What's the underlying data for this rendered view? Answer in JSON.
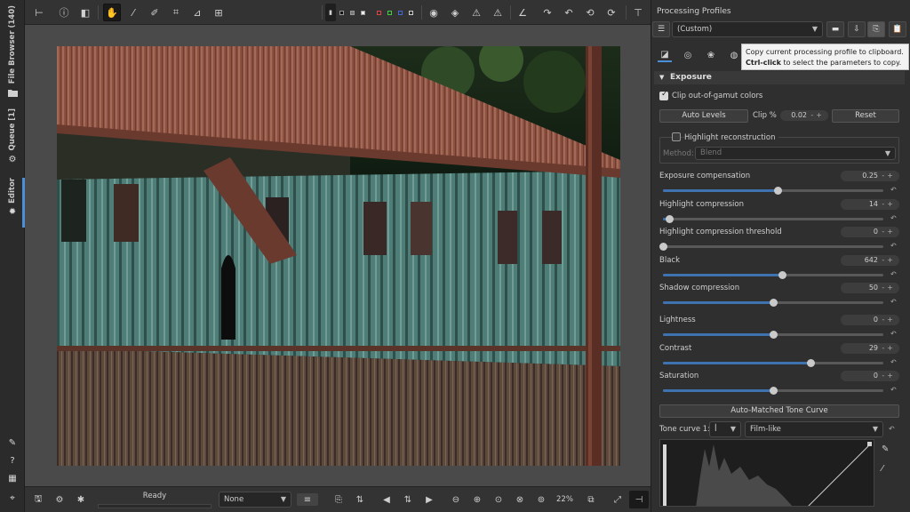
{
  "left_tabs": {
    "file_browser": "File Browser (140)",
    "queue": "Queue [1]",
    "editor": "Editor"
  },
  "status": {
    "ready": "Ready",
    "preview_mode": "None",
    "zoom": "22%"
  },
  "right_panel": {
    "title": "Processing Profiles",
    "profile_value": "(Custom)",
    "tooltip_line1": "Copy current processing profile to clipboard.",
    "tooltip_bold": "Ctrl-click",
    "tooltip_rest": " to select the parameters to copy."
  },
  "exposure": {
    "header": "Exposure",
    "clip_gamut": "Clip out-of-gamut colors",
    "auto_levels": "Auto Levels",
    "clip_label": "Clip %",
    "clip_value": "0.02",
    "reset": "Reset",
    "highlight_recon": "Highlight reconstruction",
    "method_label": "Method:",
    "method_value": "Blend",
    "sliders": [
      {
        "label": "Exposure compensation",
        "value": "0.25",
        "frac": 0.52
      },
      {
        "label": "Highlight compression",
        "value": "14",
        "frac": 0.03
      },
      {
        "label": "Highlight compression threshold",
        "value": "0",
        "frac": 0.0
      },
      {
        "label": "Black",
        "value": "642",
        "frac": 0.54
      },
      {
        "label": "Shadow compression",
        "value": "50",
        "frac": 0.5
      },
      {
        "label": "Lightness",
        "value": "0",
        "frac": 0.5
      },
      {
        "label": "Contrast",
        "value": "29",
        "frac": 0.67
      },
      {
        "label": "Saturation",
        "value": "0",
        "frac": 0.5
      }
    ],
    "auto_matched": "Auto-Matched Tone Curve",
    "tone_curve_label": "Tone curve 1:",
    "tone_curve_mode": "Film-like"
  },
  "colors": {
    "accent": "#3e73b0",
    "active_tab": "#4a8fd8"
  }
}
